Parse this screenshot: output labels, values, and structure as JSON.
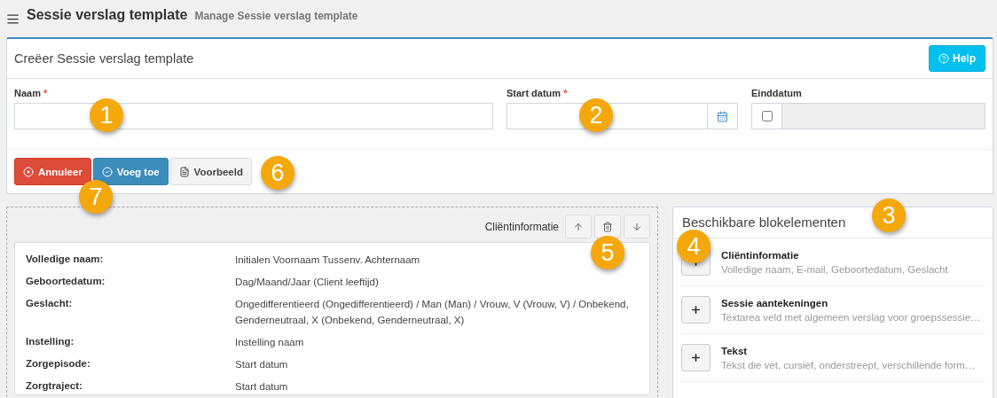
{
  "header": {
    "title": "Sessie verslag template",
    "subtitle": "Manage Sessie verslag template"
  },
  "card": {
    "title": "Creëer Sessie verslag template",
    "help_button": "Help"
  },
  "fields": [
    {
      "kind": "text",
      "label": "Naam",
      "required_mark": "*"
    },
    {
      "kind": "date",
      "label": "Start datum",
      "required_mark": "*"
    },
    {
      "kind": "optional-date",
      "label": "Einddatum",
      "checked": false
    }
  ],
  "buttons": [
    {
      "kind": "danger",
      "label": "Annuleer"
    },
    {
      "kind": "primary",
      "label": "Voeg toe"
    },
    {
      "kind": "default",
      "label": "Voorbeeld"
    }
  ],
  "block": {
    "title": "Cliëntinformatie",
    "rows": [
      {
        "label": "Volledige naam:",
        "value": "Initialen Voornaam Tussenv. Achternaam"
      },
      {
        "label": "Geboortedatum:",
        "value": "Dag/Maand/Jaar (Client leeftijd)"
      },
      {
        "label": "Geslacht:",
        "value": "Ongedifferentieerd (Ongedifferentieerd) / Man (Man) / Vrouw, V (Vrouw, V) / Onbekend, Genderneutraal, X (Onbekend, Genderneutraal, X)"
      },
      {
        "label": "Instelling:",
        "value": "Instelling naam"
      },
      {
        "label": "Zorgepisode:",
        "value": "Start datum"
      },
      {
        "label": "Zorgtraject:",
        "value": "Start datum"
      }
    ]
  },
  "available": {
    "title": "Beschikbare blokelementen",
    "items": [
      {
        "name": "Cliëntinformatie",
        "description": "Volledige naam, E-mail, Geboortedatum, Geslacht"
      },
      {
        "name": "Sessie aantekeningen",
        "description": "Textarea veld met algemeen verslag voor groepssessie…"
      },
      {
        "name": "Tekst",
        "description": "Tekst die vet, cursief, onderstreept, verschillende form…"
      }
    ]
  },
  "callouts": [
    "1",
    "2",
    "3",
    "4",
    "5",
    "6",
    "7"
  ]
}
